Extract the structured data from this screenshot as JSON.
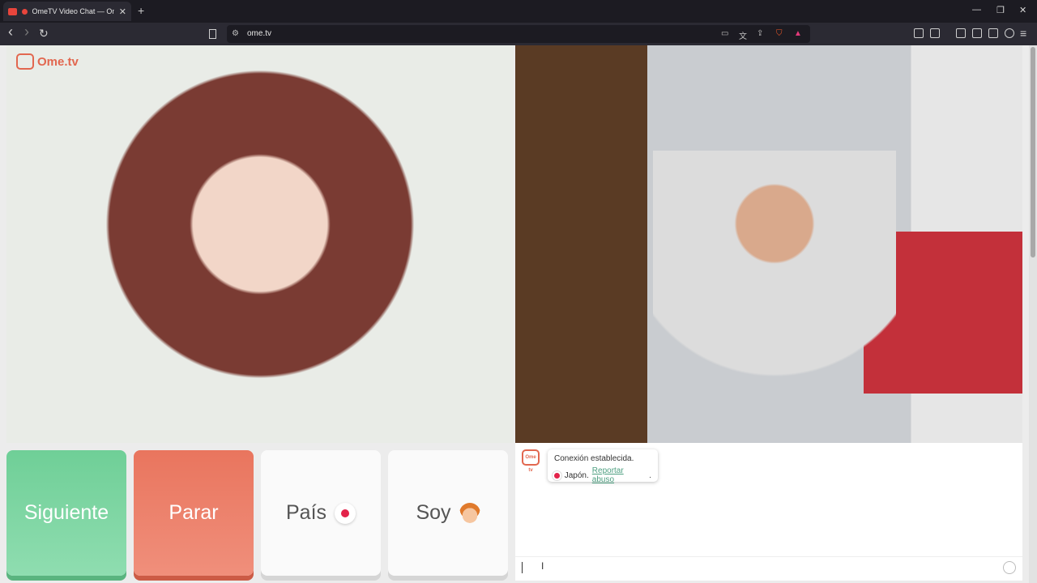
{
  "browser": {
    "tab_title": "OmeTV Video Chat — Omeg",
    "tab_close": "✕",
    "new_tab": "+",
    "url": "ome.tv",
    "window_controls": {
      "minimize": "—",
      "restore": "❐",
      "close": "✕"
    }
  },
  "nav": {
    "back": "‹",
    "forward": "›",
    "reload": "↻"
  },
  "logo": {
    "text": "Ome.tv"
  },
  "buttons": {
    "next": "Siguiente",
    "stop": "Parar",
    "country": "País",
    "soy": "Soy"
  },
  "chat": {
    "logo_small": "Ome tv",
    "connection": "Conexión establecida.",
    "country": "Japón.",
    "report": "Reportar abuso",
    "report_suffix": "."
  },
  "colors": {
    "next_green": "#6fcf97",
    "stop_red": "#e9755e",
    "brand": "#e2674f",
    "link": "#4d9f80"
  }
}
